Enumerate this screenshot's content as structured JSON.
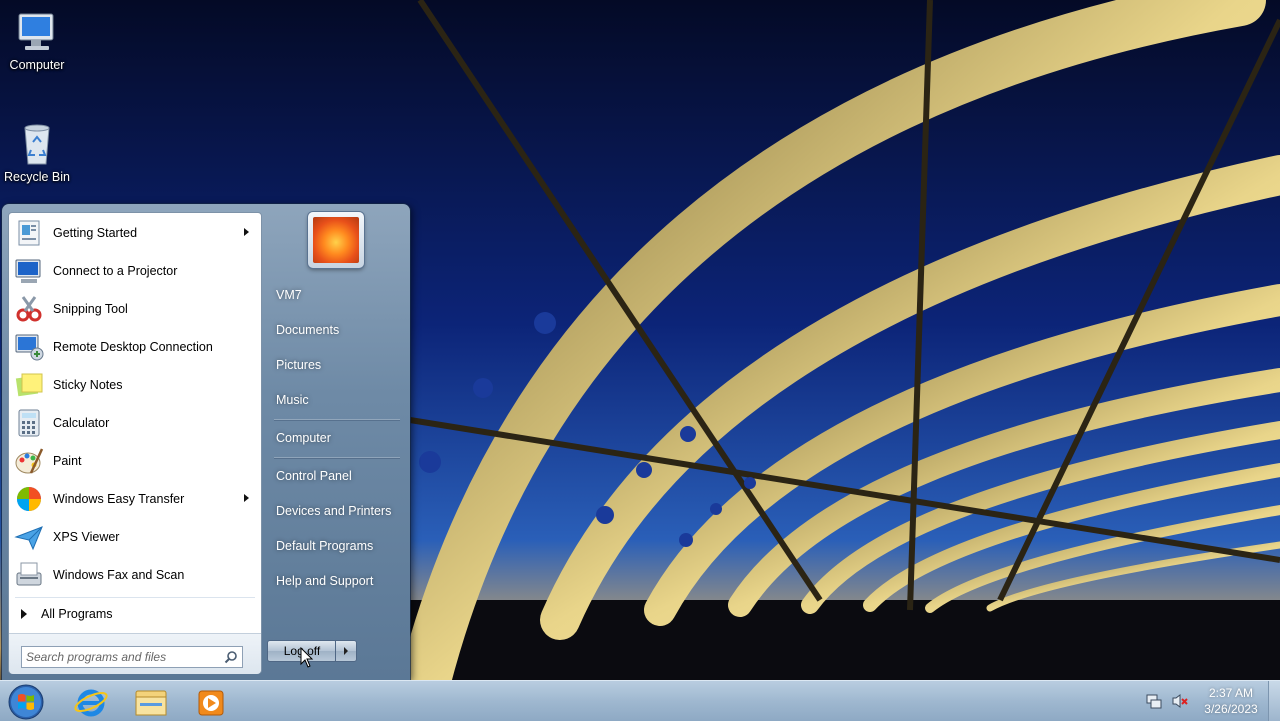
{
  "desktop": {
    "icons": [
      {
        "label": "Computer",
        "icon": "computer-icon"
      },
      {
        "label": "Recycle Bin",
        "icon": "recycle-bin-icon"
      }
    ]
  },
  "start_menu": {
    "programs": [
      {
        "label": "Getting Started",
        "icon": "getting-started-icon",
        "submenu": true
      },
      {
        "label": "Connect to a Projector",
        "icon": "projector-icon",
        "submenu": false
      },
      {
        "label": "Snipping Tool",
        "icon": "scissors-icon",
        "submenu": false
      },
      {
        "label": "Remote Desktop Connection",
        "icon": "remote-desktop-icon",
        "submenu": false
      },
      {
        "label": "Sticky Notes",
        "icon": "sticky-notes-icon",
        "submenu": false
      },
      {
        "label": "Calculator",
        "icon": "calculator-icon",
        "submenu": false
      },
      {
        "label": "Paint",
        "icon": "paint-icon",
        "submenu": false
      },
      {
        "label": "Windows Easy Transfer",
        "icon": "easy-transfer-icon",
        "submenu": true
      },
      {
        "label": "XPS Viewer",
        "icon": "xps-viewer-icon",
        "submenu": false
      },
      {
        "label": "Windows Fax and Scan",
        "icon": "fax-scan-icon",
        "submenu": false
      }
    ],
    "all_programs": "All Programs",
    "search": {
      "placeholder": "Search programs and files",
      "value": ""
    },
    "right": {
      "user": "VM7",
      "documents": "Documents",
      "pictures": "Pictures",
      "music": "Music",
      "computer": "Computer",
      "control_panel": "Control Panel",
      "devices": "Devices and Printers",
      "default_programs": "Default Programs",
      "help": "Help and Support"
    },
    "shutdown_label": "Log off"
  },
  "taskbar": {
    "pinned": [
      "internet-explorer-icon",
      "windows-explorer-icon",
      "media-player-icon"
    ],
    "clock": {
      "time": "2:37 AM",
      "date": "3/26/2023"
    }
  },
  "colors": {
    "menu_frame": "#6e8aa6",
    "taskbar": "#9fb8d0",
    "sky": "#0a1b5c"
  }
}
